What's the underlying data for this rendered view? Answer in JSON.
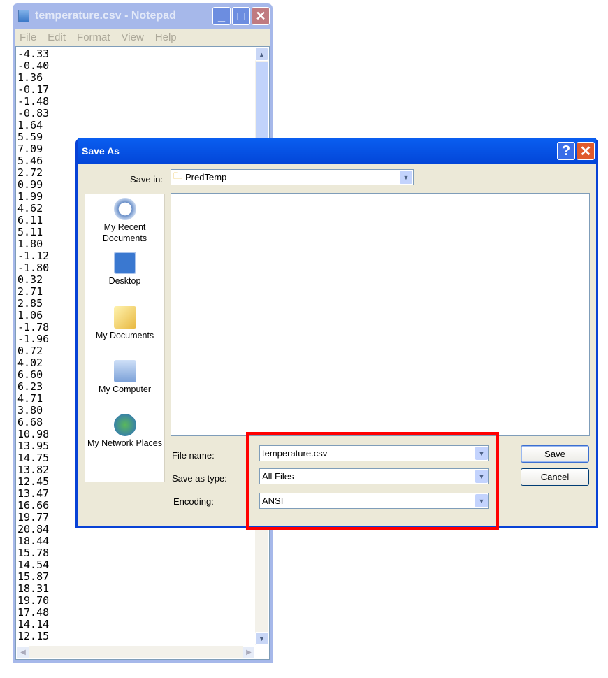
{
  "notepad": {
    "title": "temperature.csv - Notepad",
    "menu": [
      "File",
      "Edit",
      "Format",
      "View",
      "Help"
    ],
    "lines": [
      "-4.33",
      "-0.40",
      "1.36",
      "-0.17",
      "-1.48",
      "-0.83",
      "1.64",
      "5.59",
      "7.09",
      "5.46",
      "2.72",
      "0.99",
      "1.99",
      "4.62",
      "6.11",
      "5.11",
      "1.80",
      "-1.12",
      "-1.80",
      "0.32",
      "2.71",
      "2.85",
      "1.06",
      "-1.78",
      "-1.96",
      "0.72",
      "4.02",
      "6.60",
      "6.23",
      "4.71",
      "3.80",
      "6.68",
      "10.98",
      "13.95",
      "14.75",
      "13.82",
      "12.45",
      "13.47",
      "16.66",
      "19.77",
      "20.84",
      "18.44",
      "15.78",
      "14.54",
      "15.87",
      "18.31",
      "19.70",
      "17.48",
      "14.14",
      "12.15"
    ]
  },
  "dialog": {
    "title": "Save As",
    "save_in_label": "Save in:",
    "save_in_value": "PredTemp",
    "places": [
      "My Recent Documents",
      "Desktop",
      "My Documents",
      "My Computer",
      "My Network Places"
    ],
    "file_name_label": "File name:",
    "file_name_value": "temperature.csv",
    "save_as_type_label": "Save as type:",
    "save_as_type_value": "All Files",
    "encoding_label": "Encoding:",
    "encoding_value": "ANSI",
    "save_button": "Save",
    "cancel_button": "Cancel",
    "help_button": "?"
  },
  "highlight_color": "#ff0000"
}
